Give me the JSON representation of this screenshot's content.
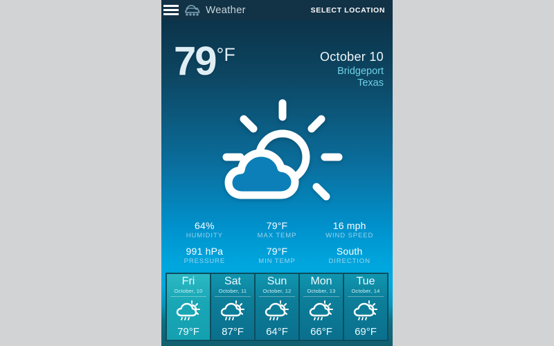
{
  "header": {
    "menu_icon": "hamburger-menu-icon",
    "logo_icon": "rain-cloud-logo-icon",
    "title": "Weather",
    "select_location_label": "SELECT LOCATION"
  },
  "current": {
    "temperature": "79",
    "unit": "°F",
    "date": "October  10",
    "city": "Bridgeport",
    "region": "Texas",
    "condition_icon": "sun-behind-cloud-icon"
  },
  "stats": {
    "row1": [
      {
        "value": "64%",
        "label": "HUMIDITY"
      },
      {
        "value": "79°F",
        "label": "MAX TEMP"
      },
      {
        "value": "16 mph",
        "label": "WIND SPEED"
      }
    ],
    "row2": [
      {
        "value": "991 hPa",
        "label": "PRESSURE"
      },
      {
        "value": "79°F",
        "label": "MIN TEMP"
      },
      {
        "value": "South",
        "label": "DIRECTION"
      }
    ]
  },
  "forecast": {
    "icon": "sun-cloud-rain-icon",
    "days": [
      {
        "day": "Fri",
        "date": "October, 10",
        "temp": "79°F",
        "active": true
      },
      {
        "day": "Sat",
        "date": "October, 11",
        "temp": "87°F",
        "active": false
      },
      {
        "day": "Sun",
        "date": "October, 12",
        "temp": "64°F",
        "active": false
      },
      {
        "day": "Mon",
        "date": "October, 13",
        "temp": "66°F",
        "active": false
      },
      {
        "day": "Tue",
        "date": "October, 14",
        "temp": "69°F",
        "active": false
      }
    ]
  },
  "colors": {
    "page_background": "#d1d3d4",
    "titlebar": "#123246",
    "gradient_top": "#0b2f46",
    "gradient_mid": "#00a9e0",
    "accent_cyan": "#6fd0e8",
    "forecast_panel": "#0c4e5e",
    "forecast_tile": "#0d7e99",
    "forecast_tile_active": "#19a6b5"
  }
}
